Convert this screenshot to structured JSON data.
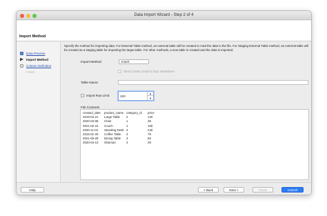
{
  "window": {
    "title": "Data Import Wizard - Step 2 of 4"
  },
  "header": {
    "title": "Import Method"
  },
  "sidebar": {
    "steps": [
      {
        "label": "Data Preview"
      },
      {
        "label": "Import Method"
      },
      {
        "label": "Column Definition"
      },
      {
        "label": "Finish"
      }
    ]
  },
  "main": {
    "description": "Specify the method for importing data.  For External Table method, an external table will be created to read the data in the file.  For Staging External Table method, an external table will be created as a staging table for importing the target table.  For other methods, a new table is created and the data is imported.",
    "import_method_label": "Import Method:",
    "import_method_value": "Insert",
    "send_script_label": "Send Create Script to SQL Worksheet",
    "table_name_label": "Table Name:",
    "table_name_value": "",
    "row_limit_label": "Import Row Limit:",
    "row_limit_value": "100",
    "file_contents_label": "File Contents"
  },
  "file_contents": {
    "headers": [
      "created_date",
      "product_name",
      "category_id",
      "price"
    ],
    "rows": [
      [
        "2019-04-21",
        "Large Table",
        "2",
        "120"
      ],
      [
        "2020-03-08",
        "Chair",
        "1",
        "39"
      ],
      [
        "2021-02-16",
        "Couch",
        "1",
        "100"
      ],
      [
        "2020-11-04",
        "Standing Desk",
        "3",
        "240"
      ],
      [
        "2015-01-20",
        "Coffee Table",
        "3",
        "79"
      ],
      [
        "2021-06-29",
        "Dining Table",
        "3",
        "60"
      ],
      [
        "2020-04-13",
        "Ottoman",
        "4",
        "29"
      ]
    ]
  },
  "footer": {
    "help": "Help",
    "back": "< Back",
    "next": "Next >",
    "finish": "Finish",
    "cancel": "Cancel"
  }
}
